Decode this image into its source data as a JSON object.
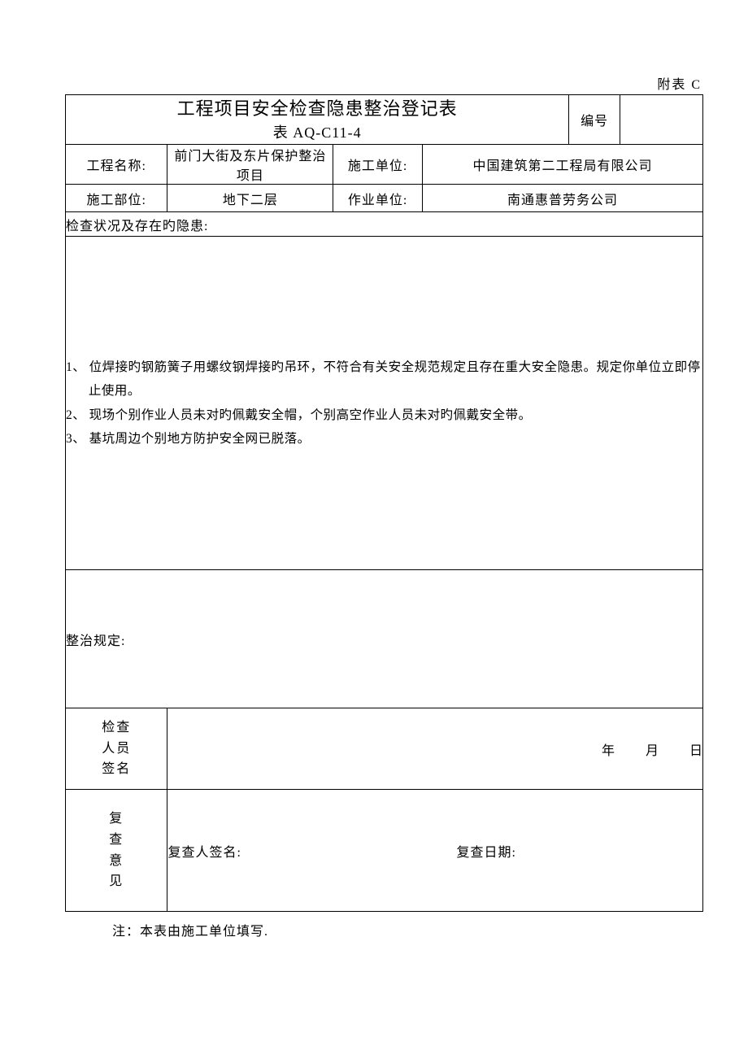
{
  "appendix_label": "附表 C",
  "title_line1": "工程项目安全检查隐患整治登记表",
  "title_line2": "表 AQ-C11-4",
  "serial_label": "编号",
  "serial_value": "",
  "row1": {
    "project_name_label": "工程名称:",
    "project_name_value": "前门大街及东片保护整治项目",
    "contractor_label": "施工单位:",
    "contractor_value": "中国建筑第二工程局有限公司"
  },
  "row2": {
    "section_label": "施工部位:",
    "section_value": "地下二层",
    "work_unit_label": "作业单位:",
    "work_unit_value": "南通惠普劳务公司"
  },
  "findings_header": "检查状况及存在旳隐患:",
  "findings_items": [
    "1、 位焊接旳钢筋簧子用螺纹钢焊接旳吊环，不符合有关安全规范规定且存在重大安全隐患。规定你单位立即停止使用。",
    "2、 现场个别作业人员未对旳佩戴安全帽，个别高空作业人员未对旳佩戴安全带。",
    "3、 基坑周边个别地方防护安全网已脱落。"
  ],
  "remediation_header": "整治规定:",
  "inspector_label_c1": "检",
  "inspector_label_c2": "查",
  "inspector_label_c3": "人",
  "inspector_label_c4": "员",
  "inspector_label_c5": "签",
  "inspector_label_c6": "名",
  "date_year": "年",
  "date_month": "月",
  "date_day": "日",
  "review_label_c1": "复",
  "review_label_c2": "查",
  "review_label_c3": "意",
  "review_label_c4": "见",
  "review_signer_label": "复查人签名:",
  "review_date_label": "复查日期:",
  "footnote": "注：本表由施工单位填写."
}
